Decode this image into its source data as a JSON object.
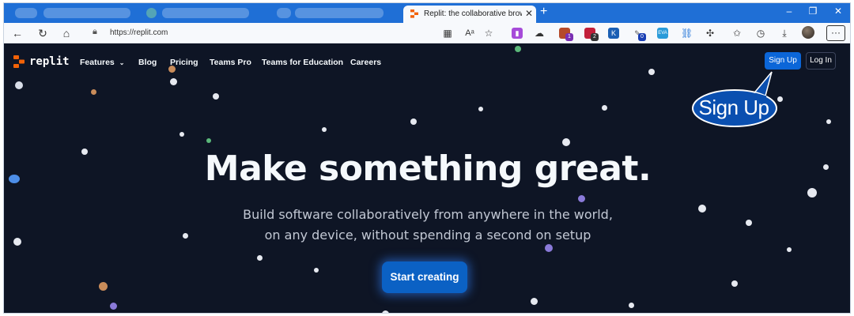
{
  "browser": {
    "active_tab_title": "Replit: the collaborative browser",
    "new_tab": "+",
    "url": "https://replit.com",
    "menu_label": "···",
    "window_controls": {
      "minimize": "–",
      "maximize": "❐",
      "close": "✕"
    },
    "extension_badges": [
      "1",
      "2",
      "0"
    ]
  },
  "site": {
    "brand_name": "replit",
    "nav": [
      {
        "label": "Features"
      },
      {
        "label": "Blog"
      },
      {
        "label": "Pricing"
      },
      {
        "label": "Teams Pro"
      },
      {
        "label": "Teams for Education"
      },
      {
        "label": "Careers"
      }
    ],
    "signup_label": "Sign Up",
    "login_label": "Log In"
  },
  "annotation": {
    "callout_text": "Sign Up"
  },
  "hero": {
    "title": "Make something great.",
    "subtitle_line1": "Build software collaboratively from anywhere in the world,",
    "subtitle_line2": "on any device, without spending a second on setup",
    "cta_label": "Start creating"
  },
  "colors": {
    "page_bg": "#0e1525",
    "primary_blue": "#0b66d8",
    "brand_orange": "#f26207",
    "tabstrip_blue": "#1f6fd6"
  },
  "icons": {
    "back": "back-arrow-icon",
    "refresh": "refresh-icon",
    "home": "home-icon",
    "lock": "lock-icon",
    "favorite": "star-icon",
    "downloads": "download-icon",
    "history": "history-icon",
    "profile": "avatar-icon"
  }
}
